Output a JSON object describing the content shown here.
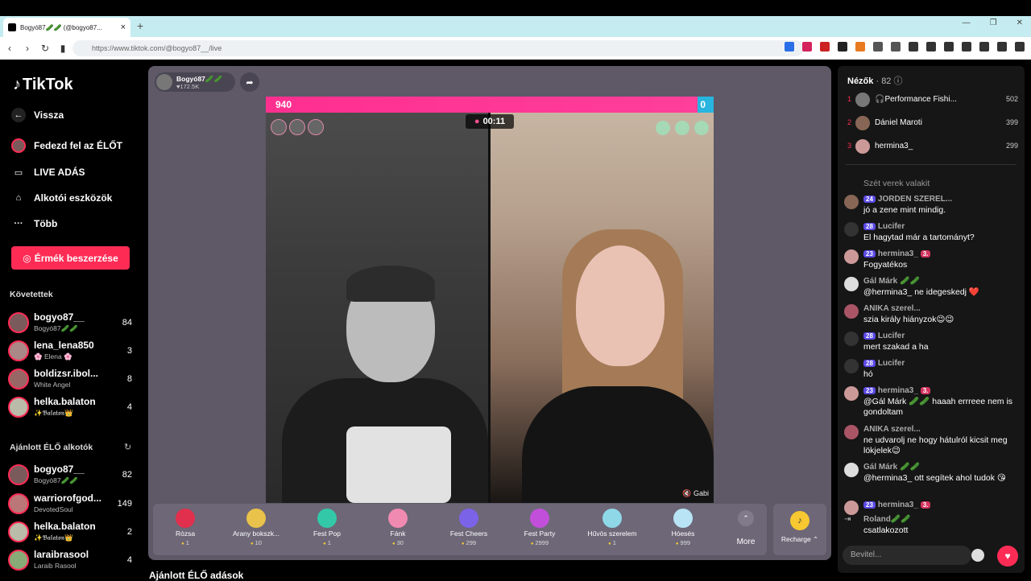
{
  "browser": {
    "tab_title": "Bogyó87🥒🥒 (@bogyo87...",
    "url": "https://www.tiktok.com/@bogyo87__/live"
  },
  "sidebar": {
    "logo": "TikTok",
    "nav": [
      {
        "label": "Vissza",
        "icon": "back-arrow-icon"
      },
      {
        "label": "Fedezd fel az ÉLŐT",
        "icon": "live-avatar-icon"
      },
      {
        "label": "LIVE ADÁS",
        "icon": "video-camera-icon"
      },
      {
        "label": "Alkotói eszközök",
        "icon": "creator-tools-icon"
      },
      {
        "label": "Több",
        "icon": "more-dots-icon"
      }
    ],
    "coin_button": "Érmék beszerzése",
    "following_header": "Követettek",
    "following": [
      {
        "name": "bogyo87__",
        "sub": "Bogyó87🥒🥒",
        "count": "84"
      },
      {
        "name": "lena_lena850",
        "sub": "🌸 Elena 🌸",
        "count": "3"
      },
      {
        "name": "boldizsr.ibol...",
        "sub": "White Angel",
        "count": "8"
      },
      {
        "name": "helka.balaton",
        "sub": "✨𝕭𝖆𝖑𝖆𝖙𝖔𝖓👑",
        "count": "4"
      }
    ],
    "recommended_header": "Ajánlott ÉLŐ alkotók",
    "recommended": [
      {
        "name": "bogyo87__",
        "sub": "Bogyó87🥒🥒",
        "count": "82"
      },
      {
        "name": "warriorofgod...",
        "sub": "DevotedSoul",
        "count": "149"
      },
      {
        "name": "helka.balaton",
        "sub": "✨𝕭𝖆𝖑𝖆𝖙𝖔𝖓👑",
        "count": "2"
      },
      {
        "name": "laraibrasool",
        "sub": "Laraib Rasool",
        "count": "4"
      }
    ]
  },
  "stage": {
    "host_name": "Bogyó87🥒🥒",
    "host_likes": "♥172.5K",
    "score_left": "940",
    "score_right": "0",
    "timer": "00:11",
    "guest_label": "Gabi"
  },
  "gifts": [
    {
      "label": "Rózsa",
      "price": "1",
      "color": "#e0304d"
    },
    {
      "label": "Arany bokszk...",
      "price": "10",
      "color": "#e8c24a"
    },
    {
      "label": "Fest Pop",
      "price": "1",
      "color": "#33c9a8"
    },
    {
      "label": "Fánk",
      "price": "30",
      "color": "#f08ab0"
    },
    {
      "label": "Fest Cheers",
      "price": "299",
      "color": "#7b63e8"
    },
    {
      "label": "Fest Party",
      "price": "2999",
      "color": "#c24fd9"
    },
    {
      "label": "Hűvös szerelem",
      "price": "1",
      "color": "#8fd8e8"
    },
    {
      "label": "Hóesés",
      "price": "999",
      "color": "#b8e4f5"
    }
  ],
  "more_label": "More",
  "recharge_label": "Recharge",
  "bottom_title": "Ajánlott ÉLŐ adások",
  "chat": {
    "viewers_label": "Nézők",
    "viewers_count": "· 82",
    "top_viewers": [
      {
        "rank": "1",
        "name": "🎧Performance Fishi...",
        "score": "502"
      },
      {
        "rank": "2",
        "name": "Dániel Maroti",
        "score": "399"
      },
      {
        "rank": "3",
        "name": "hermina3_",
        "score": "299"
      }
    ],
    "messages": [
      {
        "name": "",
        "badges": [],
        "text": "Szét verek valakit"
      },
      {
        "name": "JORDEN SZEREL...",
        "badges": [
          "24"
        ],
        "text": "jó a zene mint mindig."
      },
      {
        "name": "Lucifer",
        "badges": [
          "28"
        ],
        "text": "El hagytad már a tartományt?"
      },
      {
        "name": "hermina3_",
        "badges": [
          "23",
          "3."
        ],
        "text": "Fogyatékos"
      },
      {
        "name": "Gál Márk 🥒🥒",
        "badges": [],
        "text": "@hermina3_ ne idegeskedj ❤️"
      },
      {
        "name": "ANIKA szerel...",
        "badges": [],
        "text": "szia király hiányzok😉😉"
      },
      {
        "name": "Lucifer",
        "badges": [
          "28"
        ],
        "text": "mert szakad a ha"
      },
      {
        "name": "Lucifer",
        "badges": [
          "28"
        ],
        "text": "hó"
      },
      {
        "name": "hermina3_",
        "badges": [
          "23",
          "3."
        ],
        "text": "@Gál Márk 🥒🥒 haaah errreee nem is gondoltam"
      },
      {
        "name": "ANIKA szerel...",
        "badges": [],
        "text": "ne udvarolj ne hogy hátulról kicsit meg lökjelek😉"
      },
      {
        "name": "Gál Márk 🥒🥒",
        "badges": [],
        "text": "@hermina3_ ott segítek ahol tudok 😘"
      },
      {
        "name": "hermina3_",
        "badges": [
          "23",
          "3."
        ],
        "text": ""
      },
      {
        "name": "Roland🥒🥒",
        "badges": [],
        "text": "csatlakozott"
      }
    ],
    "input_placeholder": "Bevitel..."
  }
}
